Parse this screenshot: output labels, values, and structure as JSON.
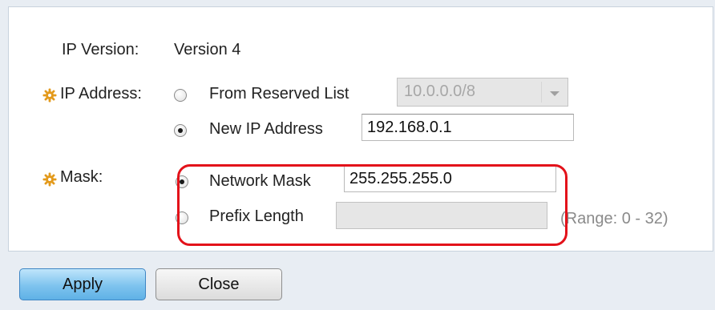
{
  "form": {
    "ip_version_label": "IP Version:",
    "ip_version_value": "Version 4",
    "ip_address_label": "IP Address:",
    "from_reserved_label": "From Reserved List",
    "reserved_select_value": "10.0.0.0/8",
    "new_ip_label": "New IP Address",
    "new_ip_value": "192.168.0.1",
    "mask_label": "Mask:",
    "network_mask_label": "Network Mask",
    "network_mask_value": "255.255.255.0",
    "prefix_length_label": "Prefix Length",
    "prefix_length_value": "",
    "prefix_range_hint": "(Range: 0 - 32)"
  },
  "selections": {
    "ip_address_mode": "new-ip-address",
    "mask_mode": "network-mask"
  },
  "buttons": {
    "apply_label": "Apply",
    "close_label": "Close"
  },
  "icons": {
    "required": "gear-asterisk-icon",
    "dropdown": "chevron-down-icon"
  },
  "colors": {
    "highlight": "#e3121a",
    "required_icon": "#e39a1c",
    "apply_button": "#7ec3ee"
  }
}
